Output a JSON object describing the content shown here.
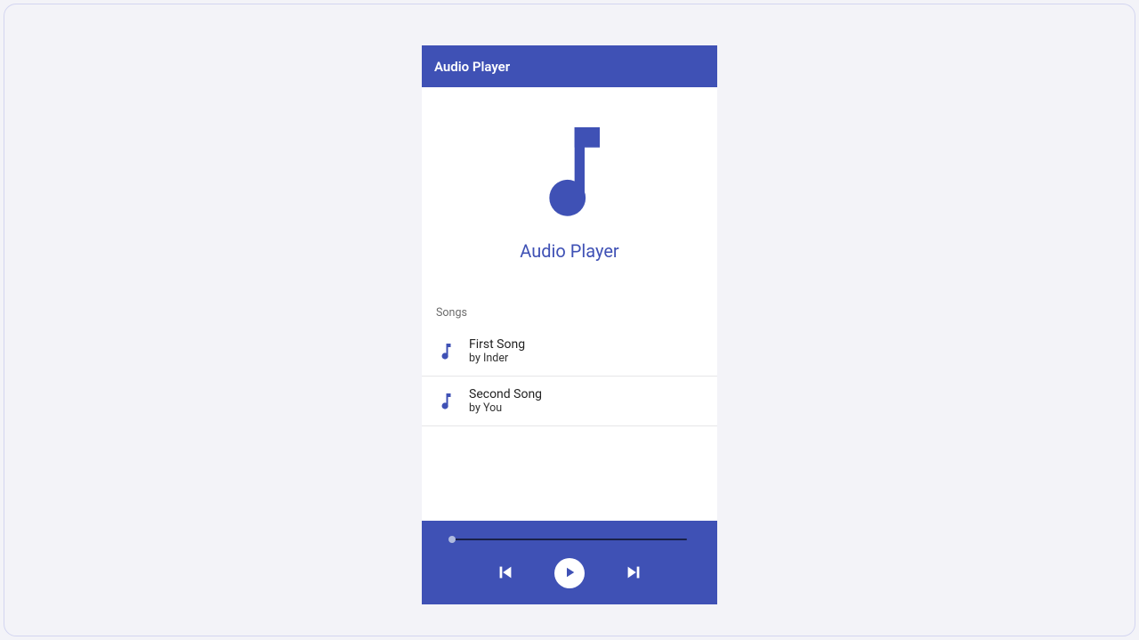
{
  "colors": {
    "primary": "#3f51b5",
    "text_muted": "#6b6b6b"
  },
  "appbar": {
    "title": "Audio Player"
  },
  "hero": {
    "label": "Audio Player",
    "icon": "music-note-icon"
  },
  "section_label": "Songs",
  "songs": [
    {
      "title": "First Song",
      "artist": "by Inder"
    },
    {
      "title": "Second Song",
      "artist": "by You"
    }
  ],
  "player": {
    "progress_percent": 0,
    "controls": {
      "prev_icon": "skip-previous-icon",
      "play_icon": "play-icon",
      "next_icon": "skip-next-icon"
    }
  }
}
